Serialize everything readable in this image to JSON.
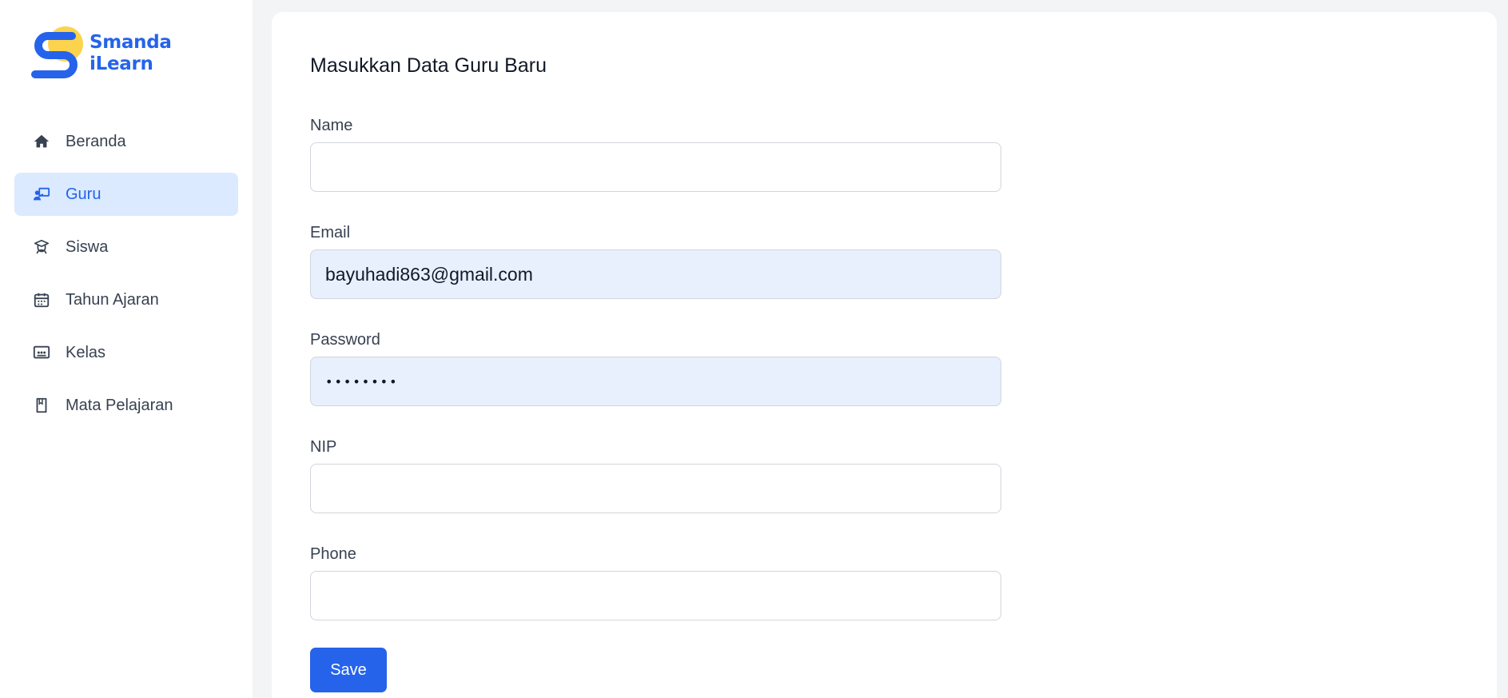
{
  "brand": {
    "line1": "Smanda",
    "line2": "iLearn",
    "primary_color": "#2563eb",
    "accent_color": "#fcd34d"
  },
  "sidebar": {
    "items": [
      {
        "label": "Beranda",
        "icon": "home-icon",
        "active": false
      },
      {
        "label": "Guru",
        "icon": "teacher-board-icon",
        "active": true
      },
      {
        "label": "Siswa",
        "icon": "graduate-student-icon",
        "active": false
      },
      {
        "label": "Tahun Ajaran",
        "icon": "calendar-icon",
        "active": false
      },
      {
        "label": "Kelas",
        "icon": "classroom-icon",
        "active": false
      },
      {
        "label": "Mata Pelajaran",
        "icon": "book-icon",
        "active": false
      }
    ]
  },
  "form": {
    "title": "Masukkan Data Guru Baru",
    "fields": {
      "name": {
        "label": "Name",
        "value": ""
      },
      "email": {
        "label": "Email",
        "value": "bayuhadi863@gmail.com"
      },
      "password": {
        "label": "Password",
        "value": "••••••••"
      },
      "nip": {
        "label": "NIP",
        "value": ""
      },
      "phone": {
        "label": "Phone",
        "value": ""
      }
    },
    "save_label": "Save"
  }
}
